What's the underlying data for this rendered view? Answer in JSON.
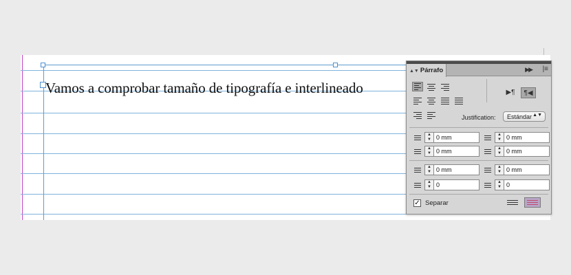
{
  "document": {
    "text": "Vamos a comprobar tamaño de tipografía e interlineado"
  },
  "panel": {
    "title": "Párrafo",
    "justification_label": "Justification:",
    "justification_value": "Estándar",
    "fields": {
      "left_indent": "0 mm",
      "right_indent": "0 mm",
      "first_line_indent": "0 mm",
      "last_line_indent": "0 mm",
      "space_before": "0 mm",
      "space_after": "0 mm",
      "drop_cap_lines": "0",
      "drop_cap_chars": "0"
    },
    "hyphenate_label": "Separar",
    "hyphenate_checked": true
  },
  "colors": {
    "margin_guide": "#c040c0",
    "baseline_grid": "#7fb2dc",
    "frame": "#5d9ccf",
    "panel_bg": "#d6d6d6"
  }
}
